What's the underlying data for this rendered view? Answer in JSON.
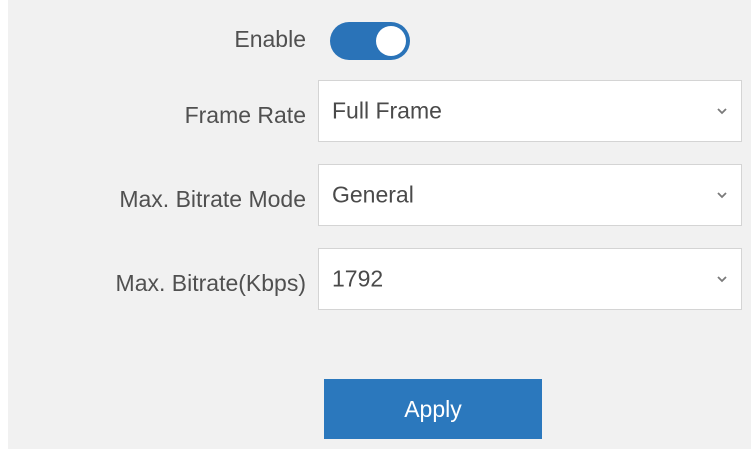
{
  "form": {
    "enable": {
      "label": "Enable",
      "state": true,
      "accent_color": "#2a73b8"
    },
    "frame_rate": {
      "label": "Frame Rate",
      "value": "Full Frame",
      "icon": "chevron-down-icon"
    },
    "max_bitrate_mode": {
      "label": "Max. Bitrate Mode",
      "value": "General",
      "icon": "chevron-down-icon"
    },
    "max_bitrate": {
      "label": "Max. Bitrate(Kbps)",
      "value": "1792",
      "icon": "chevron-down-icon"
    },
    "apply_label": "Apply",
    "apply_color": "#2b78bd"
  }
}
